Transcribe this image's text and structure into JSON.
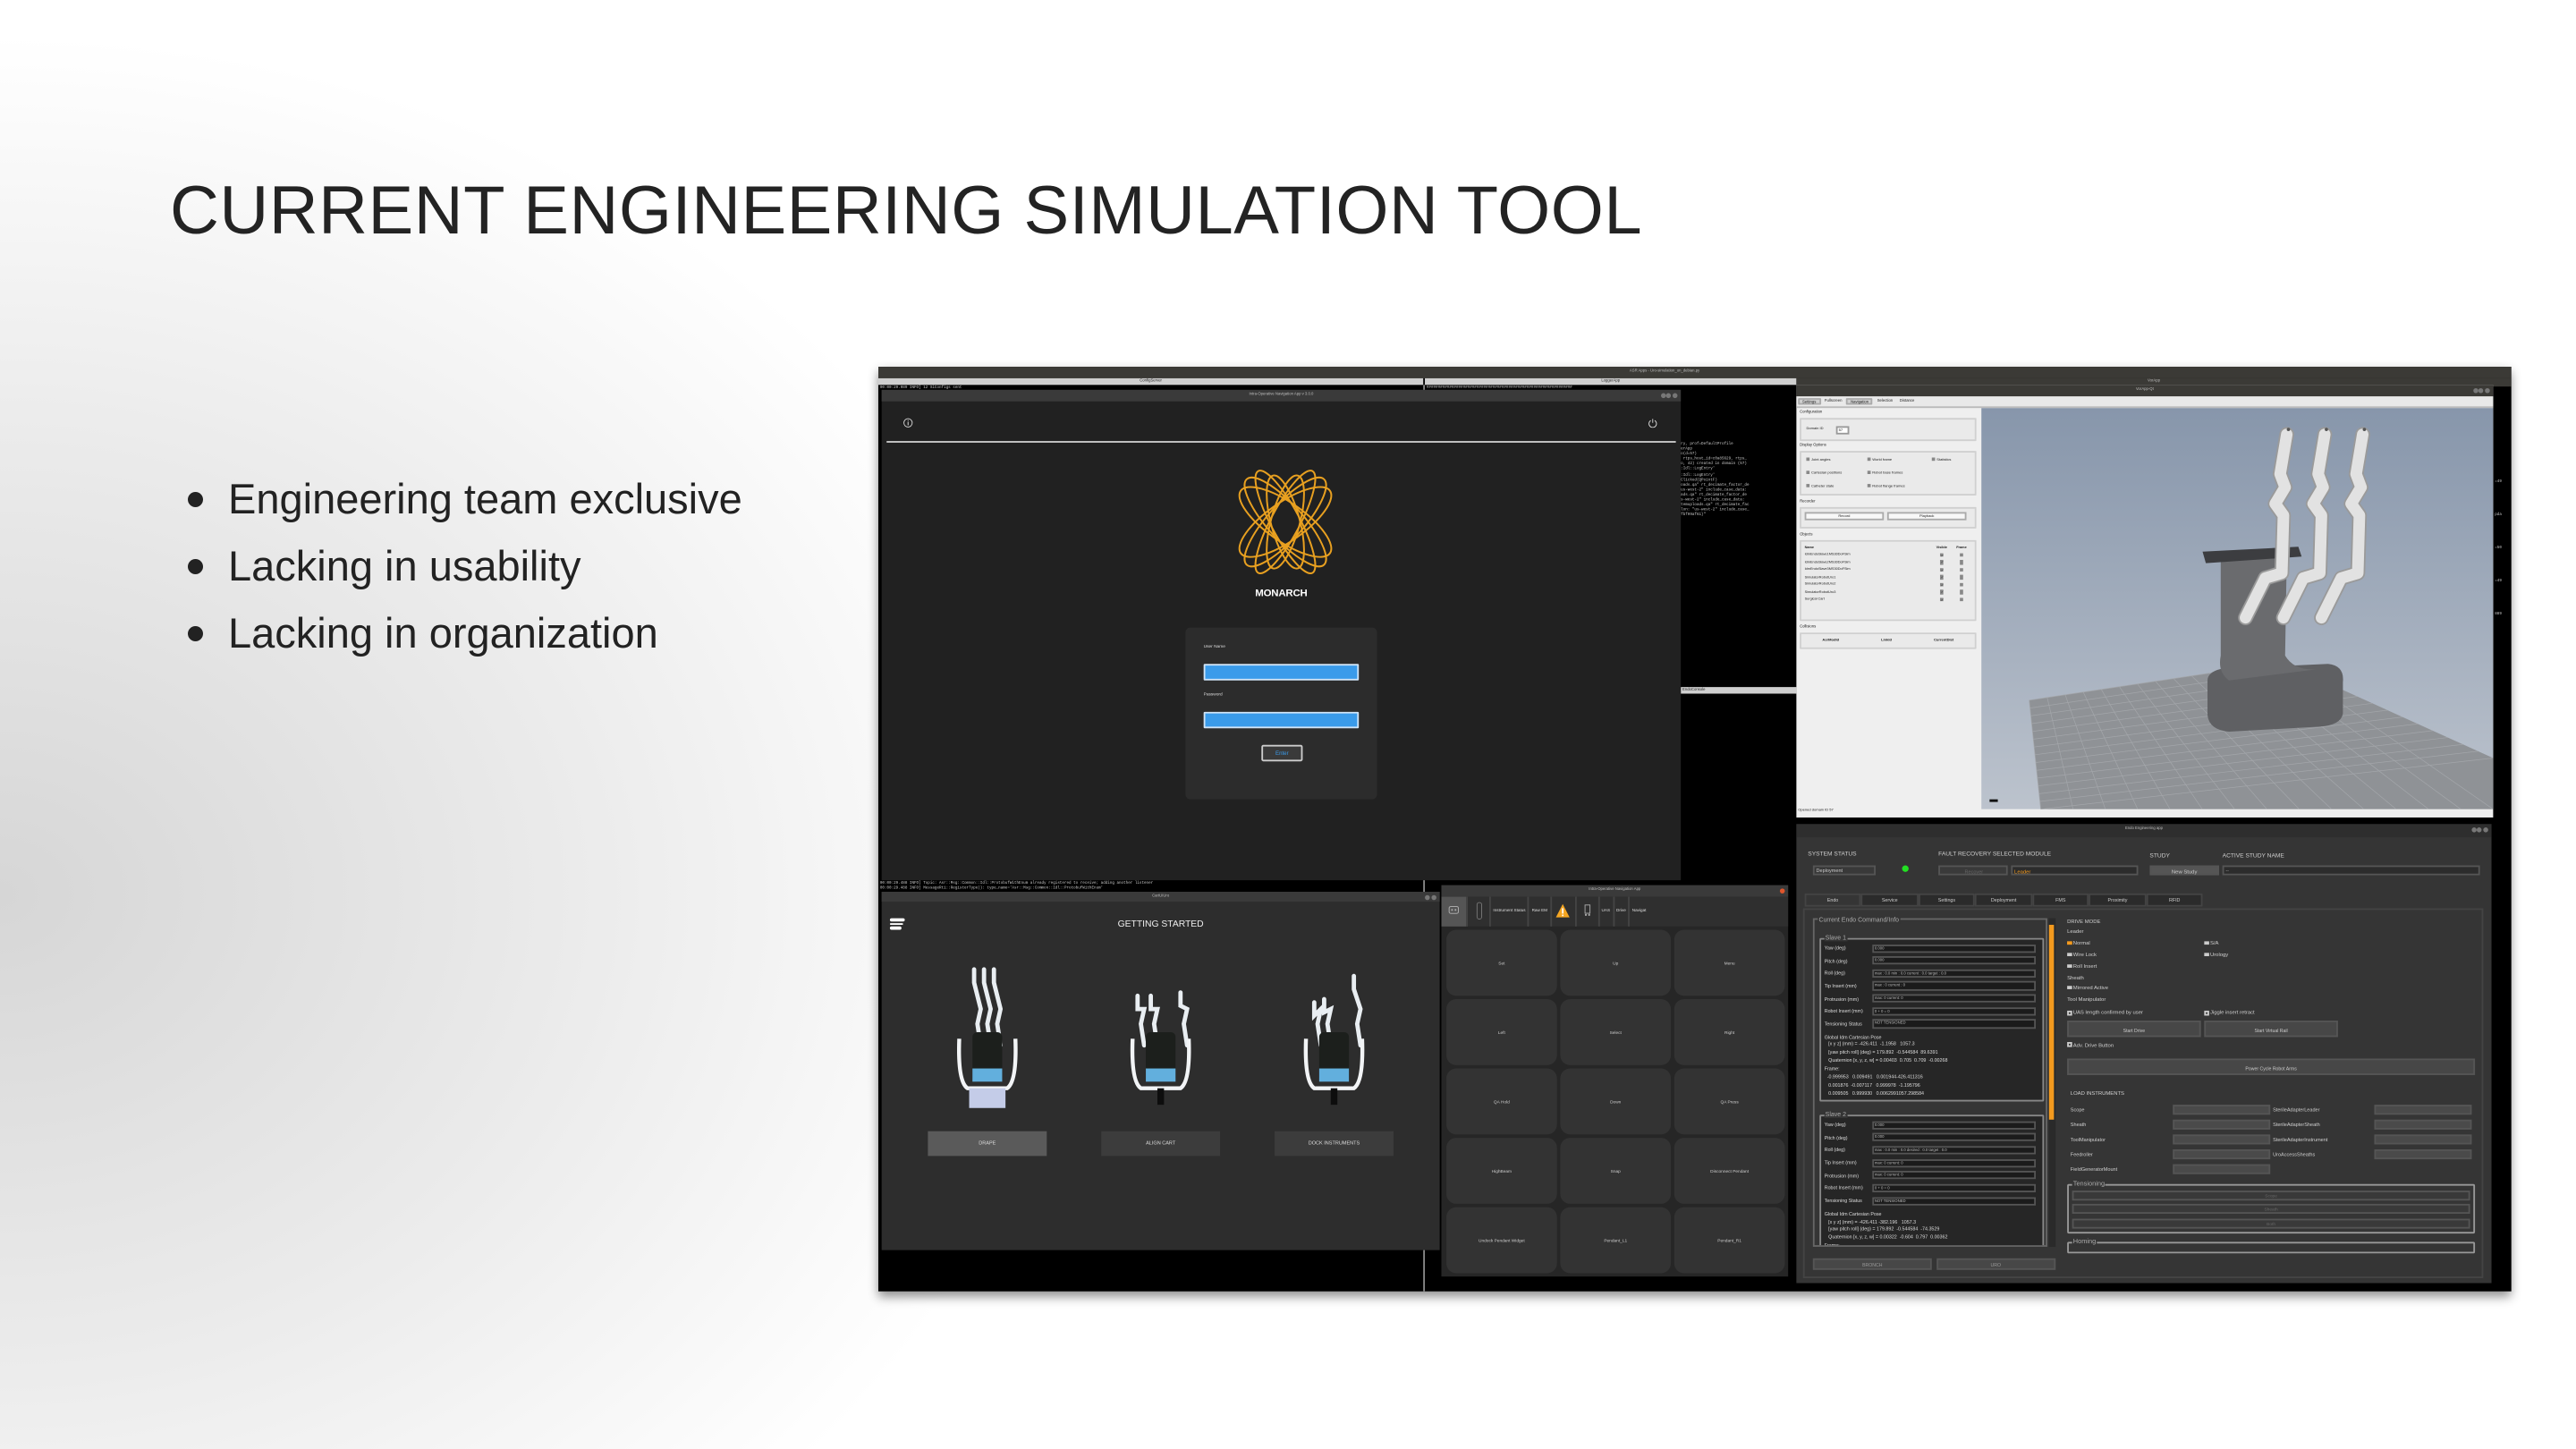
{
  "slide": {
    "title": "CURRENT ENGINEERING SIMULATION TOOL",
    "bullets": [
      "Engineering team exclusive",
      "Lacking in usability",
      "Lacking in organization"
    ]
  },
  "desktop": {
    "window_title": "ASR Apps - Uro-simulation_on_debian.py",
    "config_server": {
      "title": "ConfigServer",
      "top_line": "00:00:29.089 INFO] 12 SiConfigs sent",
      "bottom_lines": [
        "00:00:29.488 INFO] Topic: Asr::Msg::Common::Idl::ProtobufWithEnum already registered to receive; adding another listener",
        "00:00:29.488 INFO] MessageRti::RegisterType(): type_name='Asr::Msg::Common::Idl::ProtobufWithEnum'"
      ]
    },
    "logger": {
      "title": "LoggerApp",
      "header_line": "################################################################",
      "lines": [
        "ry, prof=DefaultProfile",
        "erApp",
        "o(d=57)",
        " rtps_host_id=c0a85629, rtps_",
        "",
        "o, 42) created in domain (57)",
        "",
        ":Idl::LogEntry'",
        ":Idl::LogEntry'",
        "Clicked(QPointF)",
        "oads.qa\" rt_decimate_factor_de",
        "us-west-2\" include_case_data:",
        "ads.qa\" rt_decimate_factor_de",
        "s-west-2\" include_case_data:",
        "temuploads.qa\" rt_decimate_fac",
        "lon: \"us-west-2\" include_case_",
        "fbf99af61}\""
      ]
    },
    "endo_console": {
      "title": "EndoConsole"
    },
    "right_strip": [
      "=49",
      "pda",
      "=50",
      "=49",
      "889"
    ]
  },
  "login": {
    "title": "Intra-Operative Navigation App v 3.0.0",
    "brand": "MONARCH",
    "logo_color": "#e8a020",
    "username_label": "User Name",
    "username_value": "",
    "password_label": "Password",
    "password_value": "",
    "enter_label": "Enter",
    "field_color": "#3a9bea"
  },
  "vorapp": {
    "outer_title": "VorApp",
    "title": "VorApp-Qt",
    "tabs": [
      {
        "label": "Settings",
        "active": true
      },
      {
        "label": "Fullscreen",
        "active": false
      },
      {
        "label": "Navigation",
        "active": true
      },
      {
        "label": "Selection",
        "active": false
      },
      {
        "label": "Distance",
        "active": false
      }
    ],
    "configuration_label": "Configuration",
    "domain_id_label": "Domain ID",
    "domain_id_value": "57",
    "display_options_label": "Display Options",
    "display_options": [
      {
        "label": "Joint angles",
        "checked": false
      },
      {
        "label": "World frame",
        "checked": false
      },
      {
        "label": "Statistics",
        "checked": false
      },
      {
        "label": "Cartesian positions",
        "checked": false
      },
      {
        "label": "Robot base frames",
        "checked": false
      },
      {
        "label": "Catheter state",
        "checked": false
      },
      {
        "label": "Robot flange frames",
        "checked": false
      }
    ],
    "recorder_label": "Recorder",
    "record_label": "Record",
    "playback_label": "Playback",
    "objects_label": "Objects",
    "objects_headers": [
      "Name",
      "Visible",
      "Frame"
    ],
    "objects": [
      {
        "name": "IdmEndoSlave1MS30DoFSim",
        "visible": true,
        "frame": false
      },
      {
        "name": "IdmEndoSlave2MS30DoFSim",
        "visible": true,
        "frame": false
      },
      {
        "name": "IdmEndoSlave3MS30DoFSim",
        "visible": true,
        "frame": false
      },
      {
        "name": "SimulatorRobotUro1",
        "visible": true,
        "frame": false
      },
      {
        "name": "SimulatorRobotUro2",
        "visible": true,
        "frame": false
      },
      {
        "name": "SimulatorRobotUro3",
        "visible": true,
        "frame": false
      },
      {
        "name": "Surgical Cart",
        "visible": true,
        "frame": false
      }
    ],
    "collisions_label": "Collisions",
    "collisions_headers": [
      "AsrModId",
      "LinkId",
      "CurrentDist"
    ],
    "status": "Opened domain ID 57",
    "check_mark": "✓"
  },
  "cart_ui": {
    "title": "CartUIUro",
    "heading": "GETTING STARTED",
    "steps": [
      {
        "label": "DRAPE",
        "active": true
      },
      {
        "label": "ALIGN CART",
        "active": false
      },
      {
        "label": "DOCK INSTRUMENTS",
        "active": false
      }
    ]
  },
  "pendant": {
    "title": "Intra-Operative Navigation App",
    "tabs": [
      "Instrument Status",
      "Raw EM",
      "UAS",
      "Drive",
      "Navigat"
    ],
    "tab_icons": [
      "robot-icon",
      "scope-icon",
      "warning-icon",
      "cart-icon"
    ],
    "warning_color": "#f5a623",
    "buttons": [
      "Set",
      "Up",
      "Menu",
      "Left",
      "Select",
      "Right",
      "QA Hold",
      "Down",
      "QA Press",
      "HighBeam",
      "Snap",
      "Disconnect Pendant",
      "Undock Pendant Widget",
      "Pendant_L1",
      "Pendant_R1"
    ]
  },
  "endo_app": {
    "title": "Endo Engineering app",
    "system_status_label": "SYSTEM STATUS",
    "system_status_value": "Deployment",
    "status_light_color": "#22e022",
    "fault_recovery_label": "FAULT RECOVERY SELECTED MODULE",
    "recover_label": "Recover",
    "selected_module": "Leader",
    "study_label": "STUDY",
    "new_study_label": "New Study",
    "active_study_label": "ACTIVE STUDY NAME",
    "active_study_value": "--",
    "tabs": [
      {
        "label": "Endo",
        "active": true
      },
      {
        "label": "Service",
        "active": false
      },
      {
        "label": "Settings",
        "active": false
      },
      {
        "label": "Deployment",
        "active": false
      },
      {
        "label": "FMS",
        "active": false
      },
      {
        "label": "Proximity",
        "active": false
      },
      {
        "label": "RFID",
        "active": false
      }
    ],
    "group_title": "Current Endo Command/Info",
    "slaves": [
      {
        "title": "Slave 1",
        "rows": [
          {
            "label": "Yaw   (deg)",
            "value": "0.000"
          },
          {
            "label": "Pitch  (deg)",
            "value": "0.000"
          },
          {
            "label": "Roll   (deg)",
            "value": "max : 0.0 min : 0.0 current : 0.0 target : 0.0"
          },
          {
            "label": "Tip Insert (mm)",
            "value": "max : 0  current : 0"
          },
          {
            "label": "Protrusion (mm)",
            "value": "max: 0 current: 0"
          },
          {
            "label": "Robot Insert (mm)",
            "value": "0 + 0 = 0"
          },
          {
            "label": "Tensioning Status",
            "value": "NOT TENSIONED"
          }
        ],
        "pose": [
          "Global Idm Cartesian Pose",
          "   [x y z] (mm) = -426.411  -1.1958   1057.3",
          "   [yaw pitch roll] (deg) = 179.892  -0.544584  89.6391",
          "   Quaternion [x, y, z, w] = 0.00403  0.705  0.709  -0.00268",
          "Frame:",
          "  -0.999953   0.009491   0.001944-426.411316",
          "   0.001876  -0.007117   0.999978  -1.195796",
          "   0.009505   0.999930   0.0062991057.298584"
        ]
      },
      {
        "title": "Slave 2",
        "rows": [
          {
            "label": "Yaw   (deg)",
            "value": "0.000"
          },
          {
            "label": "Pitch  (deg)",
            "value": "0.000"
          },
          {
            "label": "Roll   (deg)",
            "value": "max : 0.0 min : 0.0 desired : 0.0 target : 0.0"
          },
          {
            "label": "Tip Insert (mm)",
            "value": "max: 0  current: 0"
          },
          {
            "label": "Protrusion (mm)",
            "value": "max: 0 current: 0"
          },
          {
            "label": "Robot Insert (mm)",
            "value": "0 + 0 = 0"
          },
          {
            "label": "Tensioning Status",
            "value": "NOT TENSIONED"
          }
        ],
        "pose": [
          "Global Idm Cartesian Pose",
          "   [x y z] (mm) = -426.411 -382.196   1057.3",
          "   [yaw pitch roll] (deg) = 179.892  -0.544584  -74.3529",
          "   Quaternion [x, y, z, w] = 0.00322  -0.604  0.797  0.00362",
          "Frame:"
        ]
      }
    ],
    "drive_mode_label": "DRIVE MODE",
    "leader_label": "Leader",
    "normal_label": "Normal",
    "sa_label": "S/A",
    "wire_lock_label": "Wire Lock",
    "urology_label": "Urology",
    "roll_insert_label": "Roll Insert",
    "sheath_label": "Sheath",
    "mirrored_label": "Mirrored Active",
    "tool_manipulator_label": "Tool Manipulator",
    "uas_label": "UAS length confirmed by user",
    "jiggle_label": "Jiggle insert retract",
    "start_drive_label": "Start Drive",
    "start_virtual_rail_label": "Start Virtual Rail",
    "adv_drive_label": "Adv. Drive Button",
    "power_cycle_label": "Power Cycle Robot Arms",
    "load_instruments_label": "LOAD INSTRUMENTS",
    "instruments_left": [
      "Scope",
      "Sheath",
      "ToolManipulator",
      "Feedroller",
      "FieldGeneratorMount"
    ],
    "instruments_right": [
      "SterileAdapterLeader",
      "SterileAdapterSheath",
      "SterileAdapterInstrument",
      "UroAccessSheaths"
    ],
    "tensioning_label": "Tensioning",
    "tensioning_buttons": [
      "Scope",
      "Sheath",
      "Both"
    ],
    "homing_label": "Homing",
    "bronch_label": "BRONCH",
    "uro_label": "URO",
    "accent_color": "#f39a1e"
  }
}
